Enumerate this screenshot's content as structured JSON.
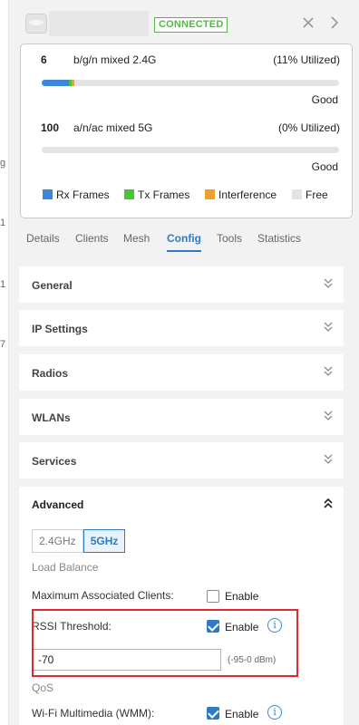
{
  "edge_chars": [
    "g",
    "1",
    "1",
    "7"
  ],
  "header": {
    "status": "CONNECTED"
  },
  "radios": [
    {
      "channel": "6",
      "mode": "b/g/n mixed  2.4G",
      "utilization": "(11% Utilized)",
      "quality": "Good",
      "rx_pct": 9,
      "tx_pct": 1,
      "interference_pct": 1
    },
    {
      "channel": "100",
      "mode": "a/n/ac mixed  5G",
      "utilization": "(0% Utilized)",
      "quality": "Good",
      "rx_pct": 0,
      "tx_pct": 0,
      "interference_pct": 0
    }
  ],
  "legend": [
    {
      "label": "Rx Frames",
      "color": "#3d87d8"
    },
    {
      "label": "Tx Frames",
      "color": "#4cc23a"
    },
    {
      "label": "Interference",
      "color": "#f0a129"
    },
    {
      "label": "Free",
      "color": "#e4e4e4"
    }
  ],
  "tabs": [
    {
      "label": "Details",
      "active": false
    },
    {
      "label": "Clients",
      "active": false
    },
    {
      "label": "Mesh",
      "active": false
    },
    {
      "label": "Config",
      "active": true
    },
    {
      "label": "Tools",
      "active": false
    },
    {
      "label": "Statistics",
      "active": false
    }
  ],
  "sections": [
    "General",
    "IP Settings",
    "Radios",
    "WLANs",
    "Services"
  ],
  "advanced": {
    "title": "Advanced",
    "bands": [
      {
        "label": "2.4GHz",
        "active": false
      },
      {
        "label": "5GHz",
        "active": true
      }
    ],
    "load_balance_heading": "Load Balance",
    "max_clients_label": "Maximum Associated Clients:",
    "max_clients_enable": "Enable",
    "max_clients_checked": false,
    "rssi_label": "RSSI Threshold:",
    "rssi_enable": "Enable",
    "rssi_checked": true,
    "rssi_value": "-70",
    "rssi_range": "(-95-0 dBm)",
    "qos_heading": "QoS",
    "wmm_label": "Wi-Fi Multimedia (WMM):",
    "wmm_enable": "Enable",
    "wmm_checked": true
  },
  "icons": {
    "close": "close-icon",
    "next": "chevron-right-icon",
    "expand": "double-chevron-down-icon",
    "collapse": "double-chevron-up-icon",
    "info": "info-icon"
  }
}
